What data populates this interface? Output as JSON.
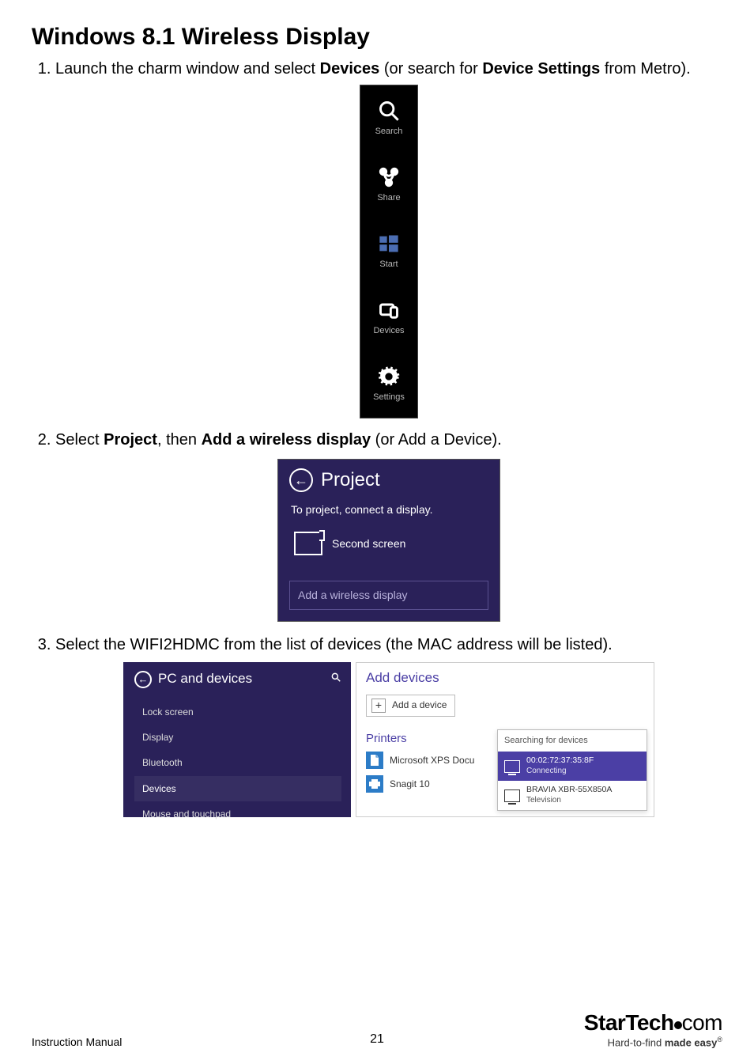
{
  "title": "Windows 8.1 Wireless Display",
  "steps": {
    "s1": {
      "pre": "Launch the charm window and select ",
      "b1": "Devices",
      "mid": " (or search for ",
      "b2": "Device Settings",
      "post": " from Metro)."
    },
    "s2": {
      "pre": "Select ",
      "b1": "Project",
      "mid": ", then ",
      "b2": "Add a wireless display",
      "post": " (or Add a Device)."
    },
    "s3": {
      "text": "Select the WIFI2HDMC from the list of devices (the MAC address will be listed)."
    }
  },
  "charm": {
    "items": [
      {
        "label": "Search",
        "icon": "search-icon"
      },
      {
        "label": "Share",
        "icon": "share-icon"
      },
      {
        "label": "Start",
        "icon": "start-icon"
      },
      {
        "label": "Devices",
        "icon": "devices-icon"
      },
      {
        "label": "Settings",
        "icon": "settings-icon"
      }
    ]
  },
  "project": {
    "title": "Project",
    "hint": "To project, connect a display.",
    "second": "Second screen",
    "add": "Add a wireless display"
  },
  "pcdev": {
    "title": "PC and devices",
    "items": [
      "Lock screen",
      "Display",
      "Bluetooth",
      "Devices",
      "Mouse and touchpad"
    ],
    "active_index": 3
  },
  "adddev": {
    "title": "Add devices",
    "addbtn": "Add a device",
    "printers_title": "Printers",
    "printers": [
      "Microsoft XPS Docu",
      "Snagit 10"
    ],
    "popup": {
      "searching": "Searching for devices",
      "dev1": {
        "name": "00:02:72:37:35:8F",
        "status": "Connecting"
      },
      "dev2": {
        "name": "BRAVIA XBR-55X850A",
        "type": "Television"
      }
    }
  },
  "footer": {
    "left": "Instruction Manual",
    "page": "21",
    "brand_bold": "StarTech",
    "brand_rest": "com",
    "tagline_pre": "Hard-to-find ",
    "tagline_bold": "made easy"
  }
}
